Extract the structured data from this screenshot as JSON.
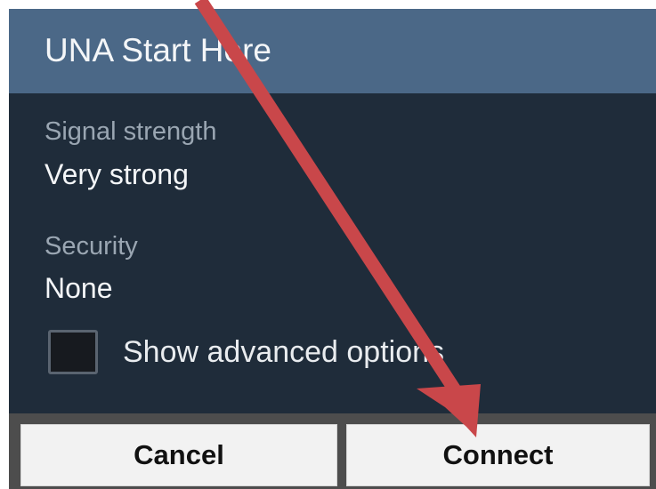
{
  "dialog": {
    "title": "UNA Start Here",
    "fields": [
      {
        "label": "Signal strength",
        "value": "Very strong"
      },
      {
        "label": "Security",
        "value": "None"
      }
    ],
    "advanced_option": {
      "label": "Show advanced options",
      "checked": false
    },
    "buttons": {
      "cancel_label": "Cancel",
      "connect_label": "Connect"
    }
  },
  "annotation": {
    "arrow_color": "#c9474a"
  }
}
